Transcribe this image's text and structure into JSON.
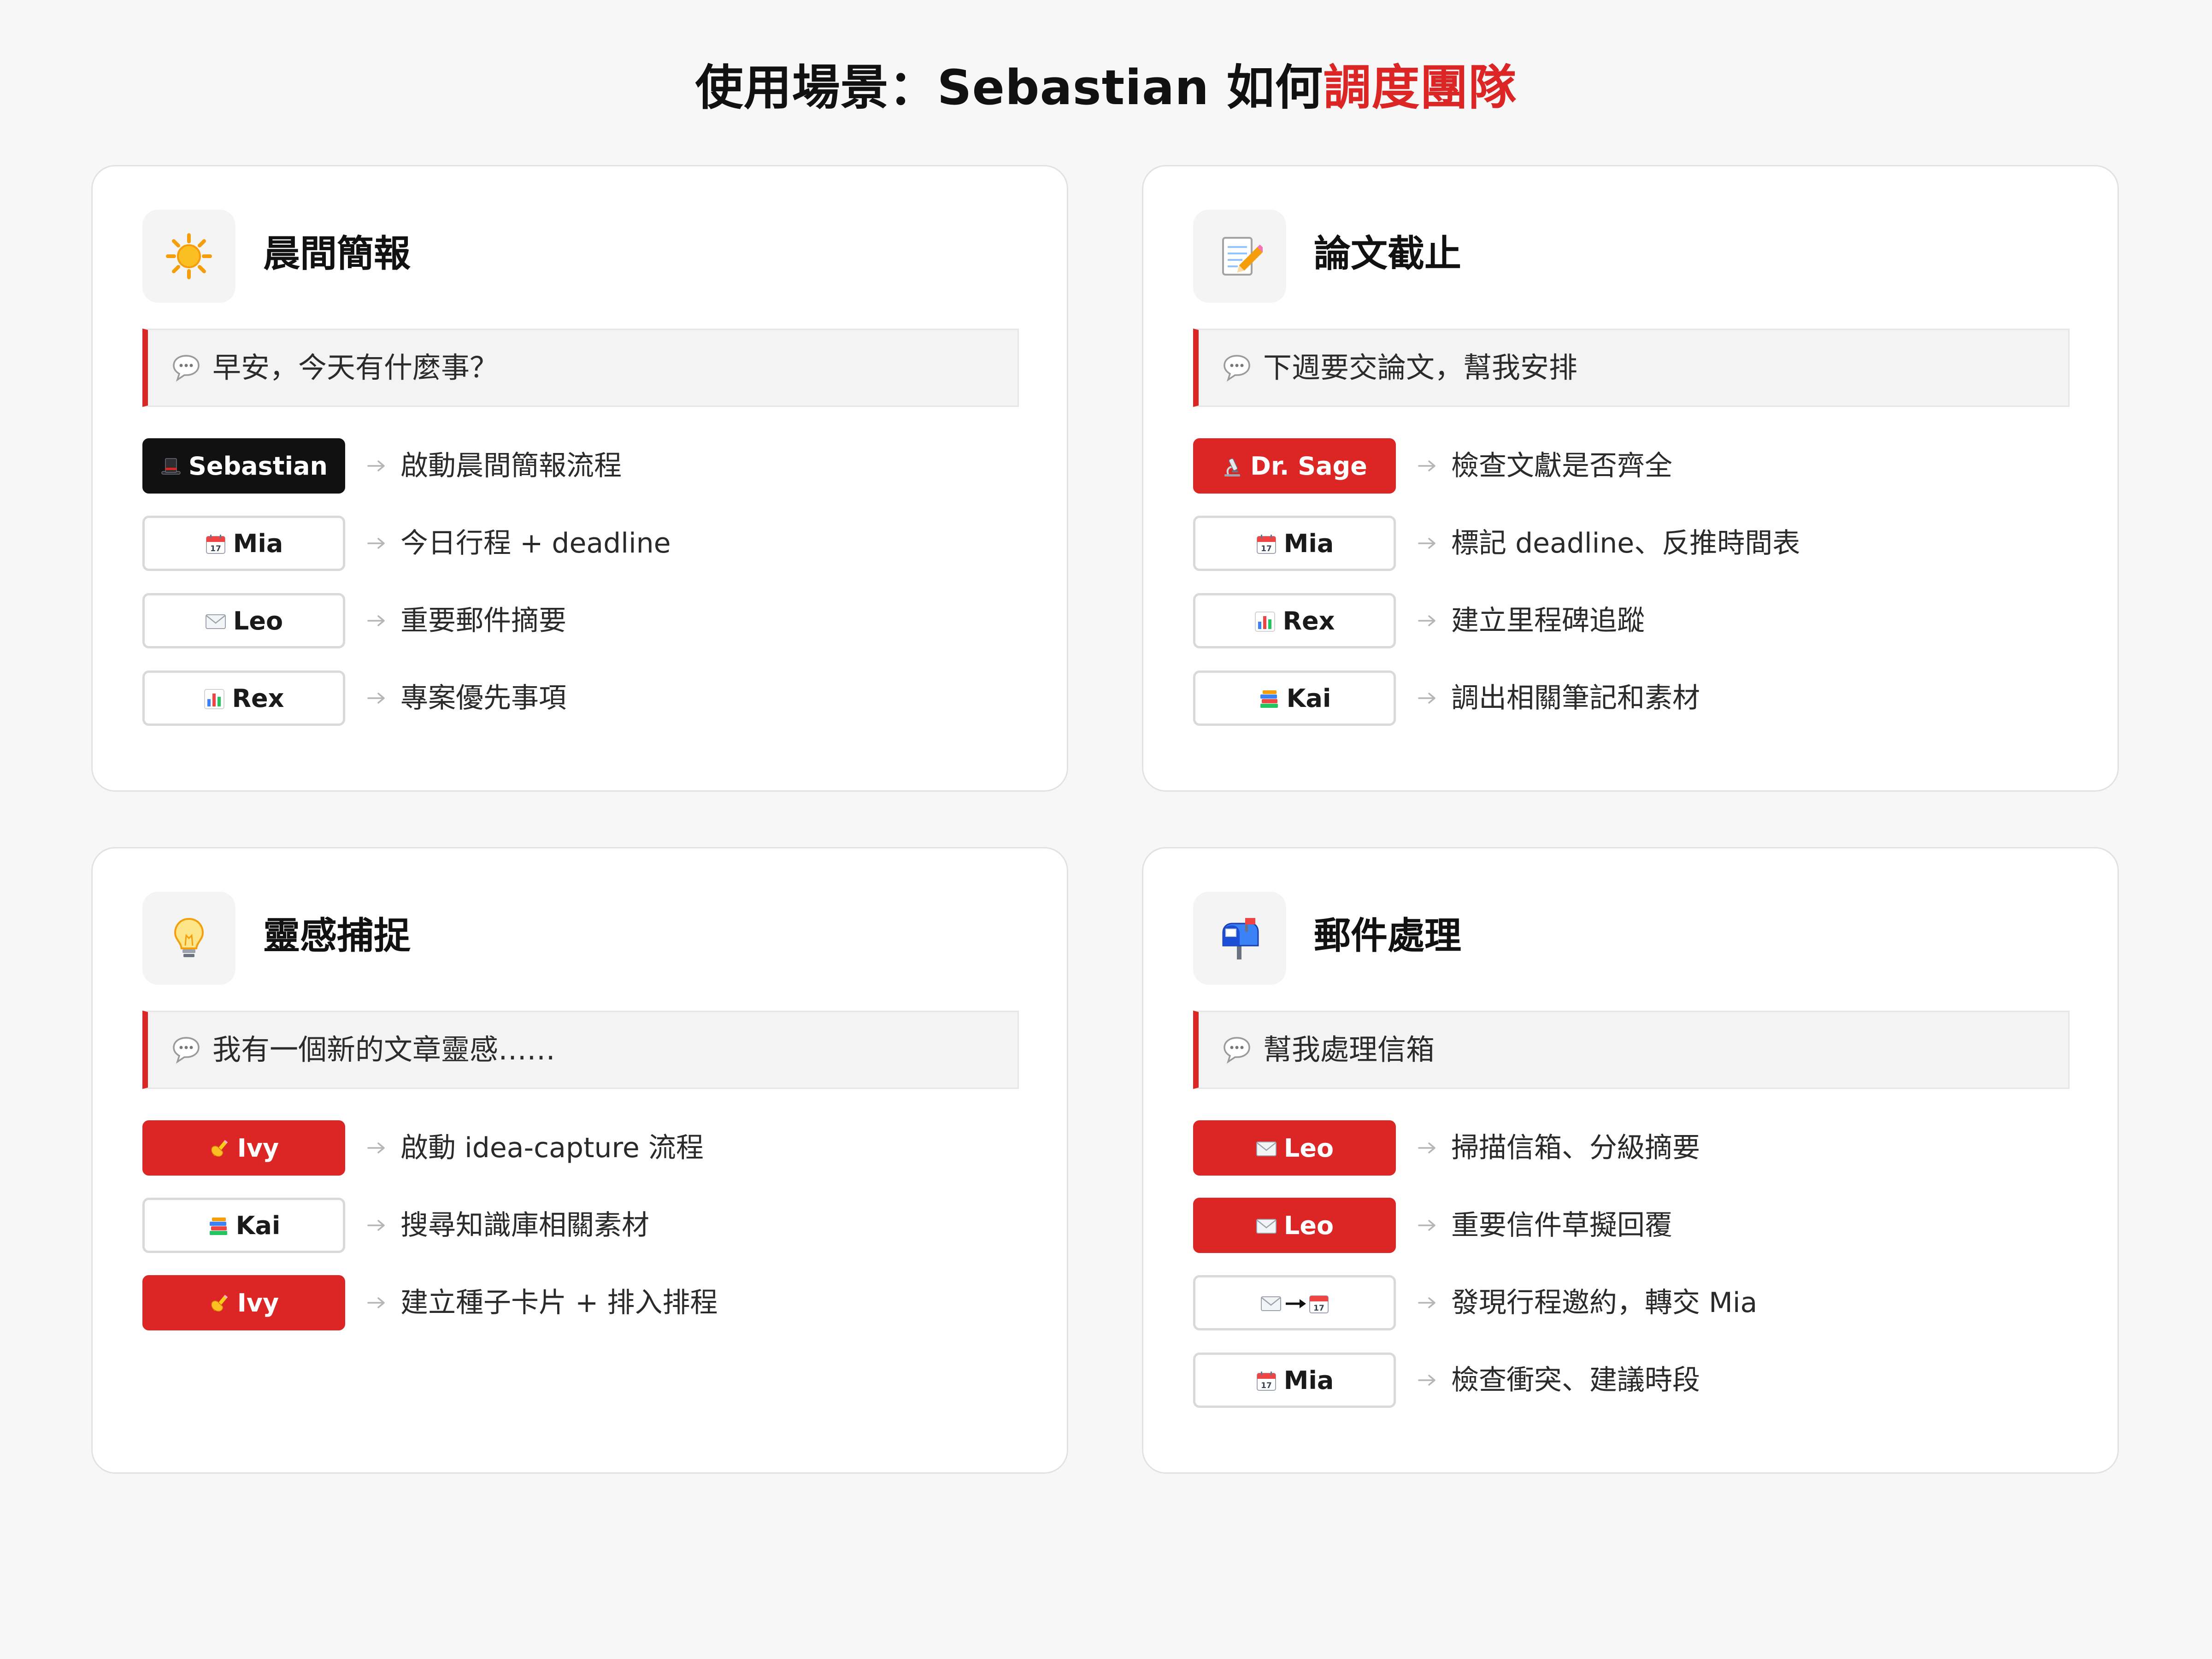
{
  "page": {
    "title_main": "使用場景：Sebastian 如何",
    "title_accent": "調度團隊"
  },
  "colors": {
    "accent": "#dc2626",
    "dark_badge": "#111111",
    "card_bg": "#ffffff",
    "page_bg": "#f7f7f7"
  },
  "cards": [
    {
      "icon": "sun-icon",
      "title": "晨間簡報",
      "prompt": "早安，今天有什麼事？",
      "tasks": [
        {
          "agent": "Sebastian",
          "icon": "tophat-icon",
          "style": "dark",
          "action": "啟動晨間簡報流程"
        },
        {
          "agent": "Mia",
          "icon": "calendar-icon",
          "style": "outline",
          "action": "今日行程 + deadline"
        },
        {
          "agent": "Leo",
          "icon": "envelope-icon",
          "style": "outline",
          "action": "重要郵件摘要"
        },
        {
          "agent": "Rex",
          "icon": "bar-chart-icon",
          "style": "outline",
          "action": "專案優先事項"
        }
      ]
    },
    {
      "icon": "memo-icon",
      "title": "論文截止",
      "prompt": "下週要交論文，幫我安排",
      "tasks": [
        {
          "agent": "Dr. Sage",
          "icon": "microscope-icon",
          "style": "red",
          "action": "檢查文獻是否齊全"
        },
        {
          "agent": "Mia",
          "icon": "calendar-icon",
          "style": "outline",
          "action": "標記 deadline、反推時間表"
        },
        {
          "agent": "Rex",
          "icon": "bar-chart-icon",
          "style": "outline",
          "action": "建立里程碑追蹤"
        },
        {
          "agent": "Kai",
          "icon": "books-icon",
          "style": "outline",
          "action": "調出相關筆記和素材"
        }
      ]
    },
    {
      "icon": "lightbulb-icon",
      "title": "靈感捕捉",
      "prompt": "我有一個新的文章靈感……",
      "tasks": [
        {
          "agent": "Ivy",
          "icon": "writing-hand-icon",
          "style": "red",
          "action": "啟動 idea-capture 流程"
        },
        {
          "agent": "Kai",
          "icon": "books-icon",
          "style": "outline",
          "action": "搜尋知識庫相關素材"
        },
        {
          "agent": "Ivy",
          "icon": "writing-hand-icon",
          "style": "red",
          "action": "建立種子卡片 + 排入排程"
        }
      ]
    },
    {
      "icon": "mailbox-icon",
      "title": "郵件處理",
      "prompt": "幫我處理信箱",
      "tasks": [
        {
          "agent": "Leo",
          "icon": "envelope-icon",
          "style": "red",
          "action": "掃描信箱、分級摘要"
        },
        {
          "agent": "Leo",
          "icon": "envelope-icon",
          "style": "red",
          "action": "重要信件草擬回覆"
        },
        {
          "agent": "",
          "icon": "envelope-to-calendar-icon",
          "style": "outline",
          "action": "發現行程邀約，轉交 Mia"
        },
        {
          "agent": "Mia",
          "icon": "calendar-icon",
          "style": "outline",
          "action": "檢查衝突、建議時段"
        }
      ]
    }
  ]
}
